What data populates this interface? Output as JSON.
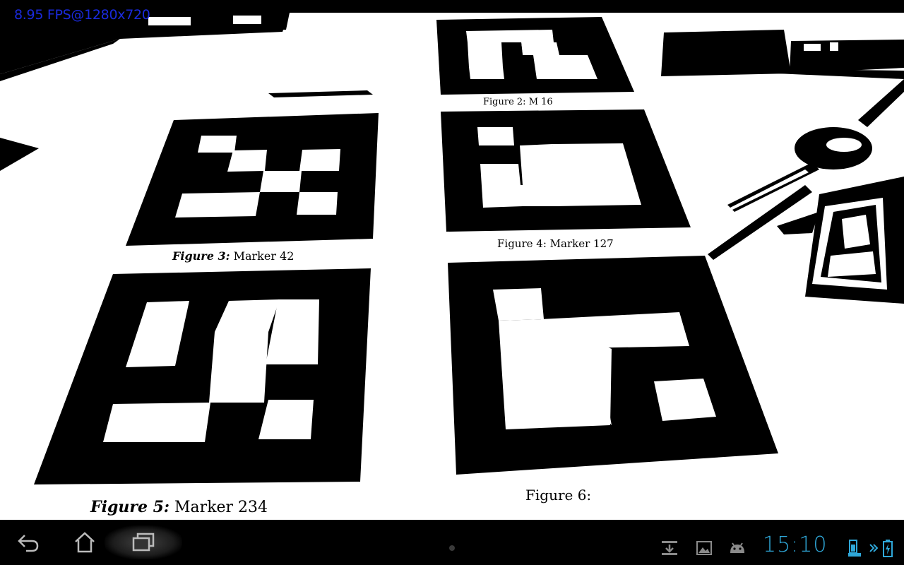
{
  "overlay": {
    "fps_text": "8.95 FPS@1280x720"
  },
  "markers": {
    "caption_3_label": "Figure 3:",
    "caption_3_text": "Marker 42",
    "caption_4_label": "Figure 4:",
    "caption_4_text": "Marker 127",
    "caption_5_label": "Figure 5:",
    "caption_5_text": "Marker 234",
    "caption_6_text": "Figure 6:"
  },
  "status_bar": {
    "time": "15:10",
    "accent_color": "#2fa7d8"
  },
  "navbar": {
    "back_icon": "back-icon",
    "home_icon": "home-icon",
    "recent_icon": "recent-apps-icon",
    "notifications": [
      "download-notification-icon",
      "gallery-notification-icon",
      "android-debug-icon"
    ],
    "battery_icons": [
      "keyboard-battery-icon",
      "tablet-battery-icon"
    ]
  }
}
